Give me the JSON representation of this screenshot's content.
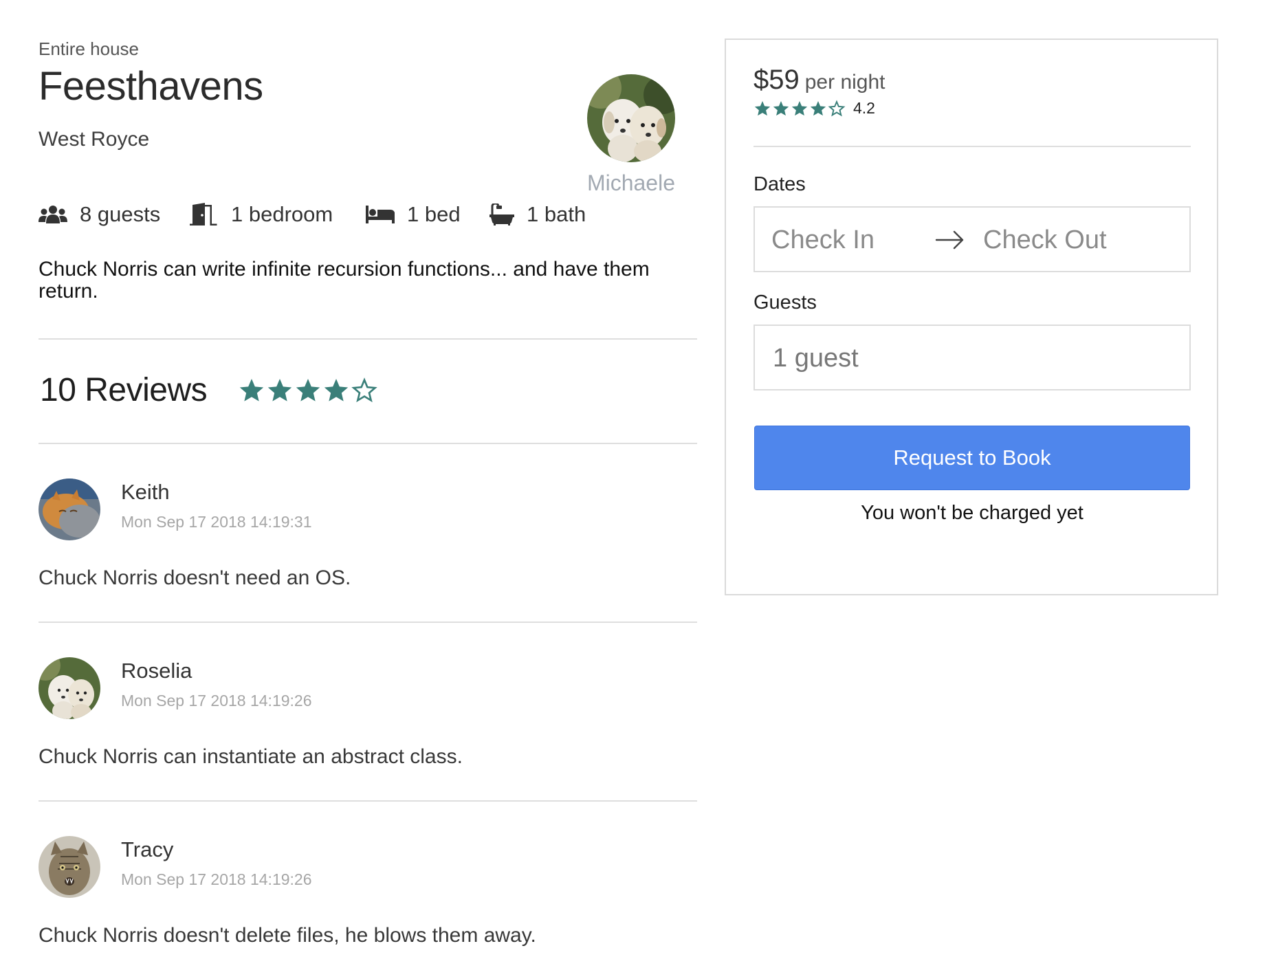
{
  "listing": {
    "property_type": "Entire house",
    "title": "Feesthavens",
    "city": "West Royce",
    "host_name": "Michaele",
    "summary": "Chuck Norris can write infinite recursion functions... and have them return.",
    "amenities": [
      {
        "icon": "guests-icon",
        "label": "8 guests"
      },
      {
        "icon": "door-icon",
        "label": "1 bedroom"
      },
      {
        "icon": "bed-icon",
        "label": "1 bed"
      },
      {
        "icon": "bathtub-icon",
        "label": "1 bath"
      }
    ]
  },
  "reviews": {
    "count_label": "10 Reviews",
    "rating": 4,
    "items": [
      {
        "name": "Keith",
        "date": "Mon Sep 17 2018 14:19:31",
        "body": "Chuck Norris doesn't need an OS."
      },
      {
        "name": "Roselia",
        "date": "Mon Sep 17 2018 14:19:26",
        "body": "Chuck Norris can instantiate an abstract class."
      },
      {
        "name": "Tracy",
        "date": "Mon Sep 17 2018 14:19:26",
        "body": "Chuck Norris doesn't delete files, he blows them away."
      }
    ]
  },
  "booking": {
    "price": "$59",
    "price_unit": "per night",
    "rating_value": "4.2",
    "rating_stars": 4,
    "dates_label": "Dates",
    "check_in_placeholder": "Check In",
    "check_out_placeholder": "Check Out",
    "guests_label": "Guests",
    "guests_value": "1 guest",
    "button_label": "Request to Book",
    "note": "You won't be charged yet"
  },
  "colors": {
    "star": "#3a7f79",
    "button": "#4f86ec",
    "host_name": "#a2a9b2"
  }
}
